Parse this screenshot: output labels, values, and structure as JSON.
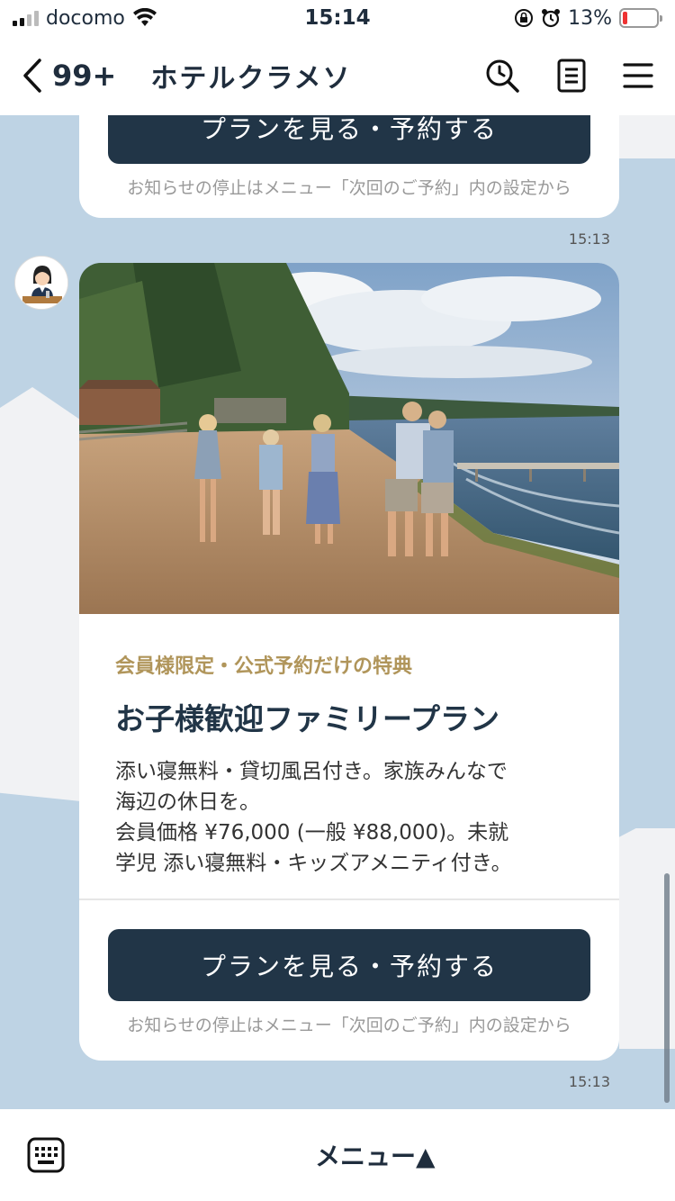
{
  "status_bar": {
    "carrier": "docomo",
    "time": "15:14",
    "battery_percent": "13%"
  },
  "header": {
    "back_count": "99+",
    "title": "ホテルクラメソ",
    "icons": [
      "search-history-icon",
      "notes-icon",
      "hamburger-menu-icon"
    ]
  },
  "chat": {
    "prev_message": {
      "button_label": "プランを見る・予約する",
      "note": "お知らせの停止はメニュー「次回のご予約」内の設定から",
      "time": "15:13"
    },
    "card": {
      "label": "会員様限定・公式予約だけの特典",
      "title": "お子様歓迎ファミリープラン",
      "description_lines": [
        "添い寝無料・貸切風呂付き。家族みんなで",
        "海辺の休日を。",
        "会員価格 ¥76,000 (一般 ¥88,000)。未就",
        "学児 添い寝無料・キッズアメニティ付き。"
      ],
      "button_label": "プランを見る・予約する",
      "note": "お知らせの停止はメニュー「次回のご予約」内の設定から",
      "time": "15:13"
    }
  },
  "bottom_bar": {
    "menu_label": "メニュー▲"
  },
  "colors": {
    "chat_background": "#bed3e4",
    "button": "#213547",
    "label_gold": "#b0955a"
  }
}
